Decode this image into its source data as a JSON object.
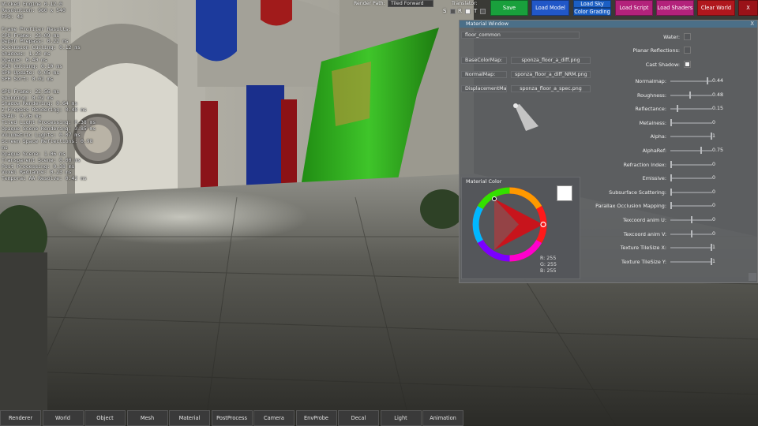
{
  "profiler": {
    "engine": "Wicked Engine 0.12.0",
    "resolution": "Resolution: 960 x 540",
    "fps": "FPS: 43",
    "lines_a": [
      "Frame Profiler Results:",
      "CPU Frame: 23.09 ms",
      "Depth Prepass: 0.22 ms",
      "Occlusion Culling: 0.12 ms",
      "Shadows: 1.23 ms",
      "Opaque: 0.40 ms",
      "GPU Culling: 0.10 ms",
      "SPH Update: 0.05 ms",
      "SPH Sort: 0.01 ms"
    ],
    "lines_b": [
      "GPU Frame: 22.56 ms",
      "Skinning: 0.02 ms",
      "Shadow Rendering: 0.64 ms",
      "Z-Prepass Rendering: 0.48 ms",
      "SSAO: 0.26 ms",
      "Tiled Light Processing: 0.38 ms",
      "Opaque Scene Rendering: 3.85 ms",
      "Volumetric Lights: 0.07 ms",
      "Screen Space Reflections: 0.98 ms",
      "Opaque Scene: 1.06 ms",
      "Transparent Scene: 0.00 ms",
      "Post Processing: 0.38 ms",
      "Voxel Radiance: 0.23 ms",
      "Temporal AA Resolve: 0.42 ms"
    ]
  },
  "topbar": {
    "render_path_label": "Render Path:",
    "render_path_value": "Tiled Forward",
    "translator_label": "Translator:",
    "srt": [
      "S",
      "R",
      "T"
    ],
    "buttons": {
      "save": "Save",
      "load_model": "Load Model",
      "load_sky": "Load Sky",
      "color_grading": "Color Grading",
      "load_script": "Load Script",
      "load_shaders": "Load Shaders",
      "clear_world": "Clear World",
      "exit": "X"
    },
    "colors": {
      "save": "#19a03c",
      "load_model": "#2157c7",
      "load_sky": "#1b5fc4",
      "load_script": "#b3227b",
      "load_shaders": "#b3227b",
      "clear_world": "#b0171d",
      "exit": "#9a1218"
    }
  },
  "material_window": {
    "title": "Material Window",
    "close": "X",
    "name_field": "floor_common",
    "textures": [
      {
        "label": "BaseColorMap:",
        "value": "sponza_floor_a_diff.png"
      },
      {
        "label": "NormalMap:",
        "value": "sponza_floor_a_diff_NRM.png"
      },
      {
        "label": "DisplacementMap:",
        "value": "sponza_floor_a_spec.png"
      }
    ],
    "checkboxes": [
      {
        "label": "Water:",
        "checked": false
      },
      {
        "label": "Planar Reflections:",
        "checked": false
      },
      {
        "label": "Cast Shadow:",
        "checked": true
      }
    ],
    "sliders": [
      {
        "label": "Normalmap:",
        "value": "0.44",
        "fraction": 0.9
      },
      {
        "label": "Roughness:",
        "value": "0.48",
        "fraction": 0.48
      },
      {
        "label": "Reflectance:",
        "value": "0.15",
        "fraction": 0.15
      },
      {
        "label": "Metalness:",
        "value": "0",
        "fraction": 0.0
      },
      {
        "label": "Alpha:",
        "value": "1",
        "fraction": 1.0
      },
      {
        "label": "AlphaRef:",
        "value": "0.75",
        "fraction": 0.75
      },
      {
        "label": "Refraction Index:",
        "value": "0",
        "fraction": 0.0
      },
      {
        "label": "Emissive:",
        "value": "0",
        "fraction": 0.0
      },
      {
        "label": "Subsurface Scattering:",
        "value": "0",
        "fraction": 0.0
      },
      {
        "label": "Parallax Occlusion Mapping:",
        "value": "0",
        "fraction": 0.0
      },
      {
        "label": "Texcoord anim U:",
        "value": "0",
        "fraction": 0.5
      },
      {
        "label": "Texcoord anim V:",
        "value": "0",
        "fraction": 0.5
      },
      {
        "label": "Texture TileSize X:",
        "value": "1",
        "fraction": 1.0
      },
      {
        "label": "Texture TileSize Y:",
        "value": "1",
        "fraction": 1.0
      }
    ],
    "color_picker": {
      "title": "Material Color",
      "r": "R: 255",
      "g": "G: 255",
      "b": "B: 255",
      "swatch": "#ffffff"
    }
  },
  "tabs": [
    "Renderer",
    "World",
    "Object",
    "Mesh",
    "Material",
    "PostProcess",
    "Camera",
    "EnvProbe",
    "Decal",
    "Light",
    "Animation"
  ]
}
